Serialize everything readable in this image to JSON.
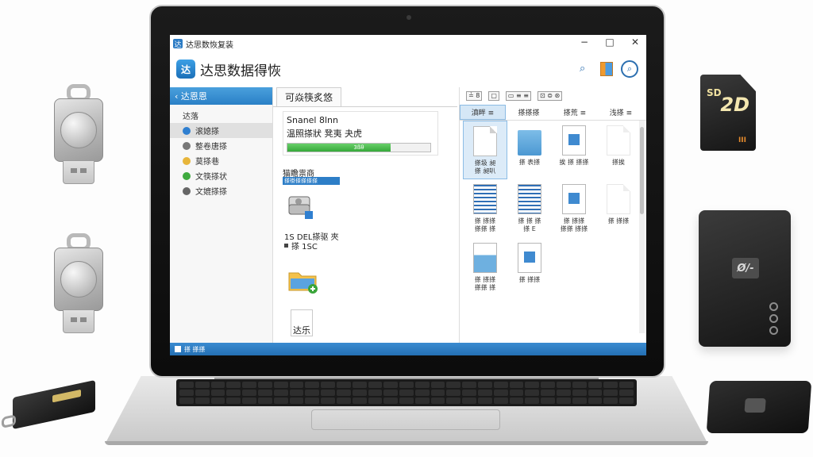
{
  "window": {
    "title": "达思数恢复装",
    "controls": {
      "minimize": "−",
      "maximize": "□",
      "close": "✕"
    }
  },
  "app": {
    "logo_glyph": "达",
    "name": "达思数据得恢",
    "tools": [
      "search-icon",
      "chart-icon",
      "scan-icon"
    ]
  },
  "sidebar": {
    "header": "‹ 达恩恩",
    "group": "达落",
    "items": [
      {
        "label": "滚媳搽",
        "icon": "disk-icon",
        "color": "#2f7fd0",
        "active": true
      },
      {
        "label": "整卷唐搽",
        "icon": "shield-icon",
        "color": "#777777",
        "active": false
      },
      {
        "label": "莫搽巷",
        "icon": "file-icon",
        "color": "#e7b53a",
        "active": false
      },
      {
        "label": "文筷搽状",
        "icon": "check-icon",
        "color": "#3faa3f",
        "active": false
      },
      {
        "label": "文媲搽搽",
        "icon": "folder-icon",
        "color": "#666666",
        "active": false
      }
    ]
  },
  "center": {
    "tab": "可焱筷炙悠",
    "scan": {
      "name": "Snanel 8lnn",
      "state": "温照搽狀 凳夷 夬虎",
      "progress_fraction": 0.72,
      "progress_text": "3ßθ"
    },
    "results_label": "猫瞻祟商",
    "results_strip": "搽褂搽搽搽搽",
    "drive": {
      "label": "1S DEL搽驱 夾",
      "size": "搽 1SC"
    },
    "doc_label": "达乐"
  },
  "grid": {
    "toolbar": [
      "≟ 8",
      "▢",
      "▭ ≡ ≡",
      "⊡ ⊜ ⊛"
    ],
    "columns": [
      "滇畔 ≡",
      "搽搽搽",
      "搽荒 ≡",
      "浅搽 ≡"
    ],
    "items": [
      {
        "kind": "page",
        "label": "搽圾 昶\n搽 昶叭",
        "selected": true
      },
      {
        "kind": "blue-folder",
        "label": "搽 表搽",
        "selected": false
      },
      {
        "kind": "doc-pic",
        "label": "挨 搽 搽搽",
        "selected": false
      },
      {
        "kind": "faded",
        "label": "搽挨",
        "selected": false
      },
      {
        "kind": "doc-lines",
        "label": "搽 搽搽\n搽搽 搽",
        "selected": false
      },
      {
        "kind": "doc-lines",
        "label": "搽 搽 搽\n搽 E",
        "selected": false
      },
      {
        "kind": "doc-pic",
        "label": "搽 搽搽\n搽搽 搽搽",
        "selected": false
      },
      {
        "kind": "faded",
        "label": "搽 搽搽",
        "selected": false
      },
      {
        "kind": "blue-doc",
        "label": "搽 搽搽\n搽搽 搽",
        "selected": false
      },
      {
        "kind": "doc-pic",
        "label": "搽 搽搽",
        "selected": false
      },
      {
        "kind": "none",
        "label": "",
        "selected": false
      },
      {
        "kind": "none",
        "label": "",
        "selected": false
      }
    ]
  },
  "status": {
    "text": "搽 搽搽"
  },
  "devices": {
    "sd_card": {
      "brand": "SD",
      "big": "2D",
      "mark": "III"
    },
    "hdd": {
      "logo": "Ø/-"
    }
  }
}
